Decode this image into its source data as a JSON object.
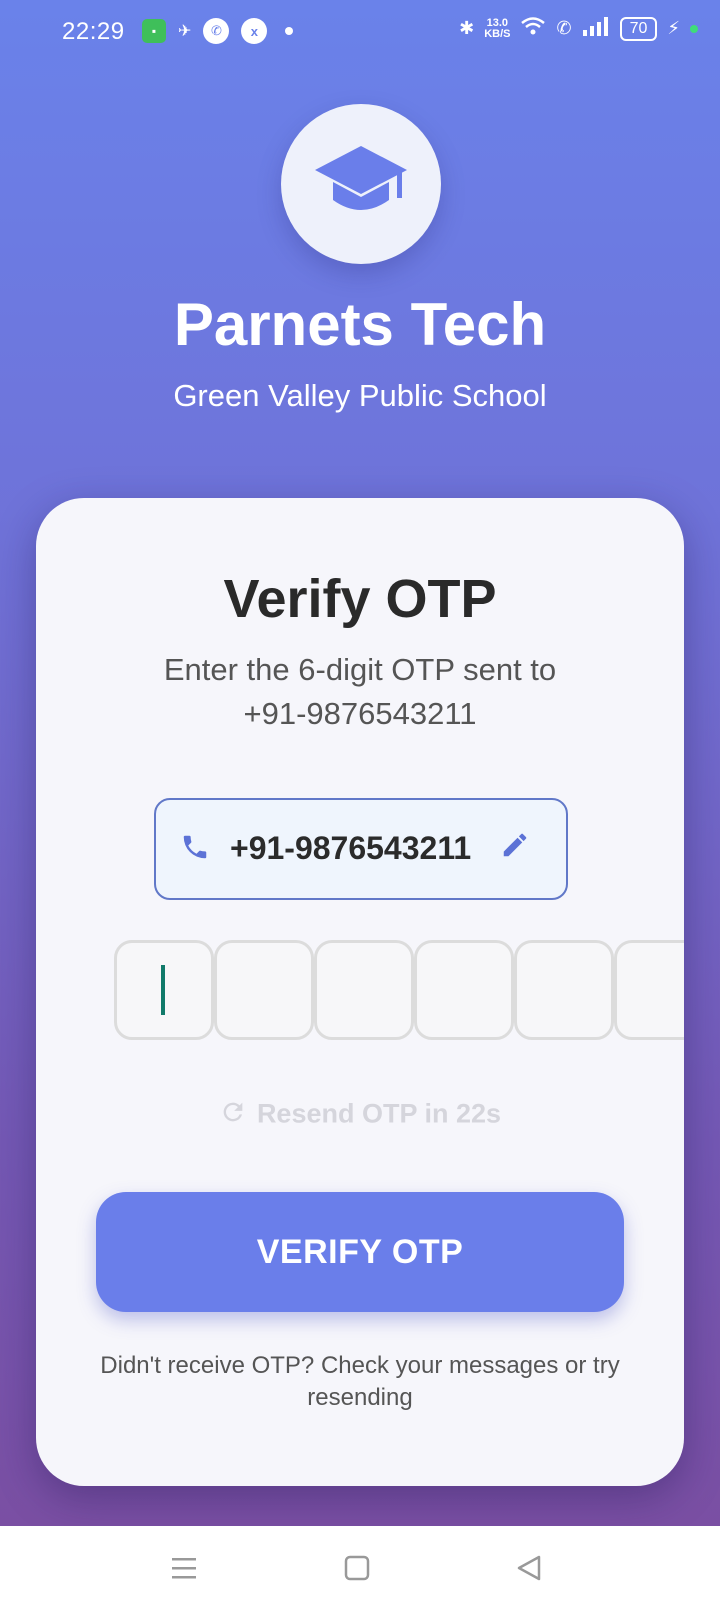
{
  "status_bar": {
    "time": "22:29",
    "speed_value": "13.0",
    "speed_unit": "KB/S",
    "battery": "70"
  },
  "header": {
    "logo_icon": "graduation-cap-icon",
    "app_title": "Parnets Tech",
    "school_name": "Green Valley Public School"
  },
  "card": {
    "title": "Verify OTP",
    "subtitle_line1": "Enter the 6-digit OTP sent to",
    "subtitle_line2": "+91-9876543211",
    "phone_number": "+91-9876543211",
    "otp_digits": [
      "",
      "",
      "",
      "",
      "",
      ""
    ],
    "resend_text": "Resend OTP in 22s",
    "verify_button": "VERIFY OTP",
    "help_text_line1": "Didn't receive OTP? Check your messages or try",
    "help_text_line2": "resending"
  },
  "colors": {
    "accent": "#6a7eea",
    "phone_border": "#6178c8",
    "cursor": "#117a6a"
  }
}
